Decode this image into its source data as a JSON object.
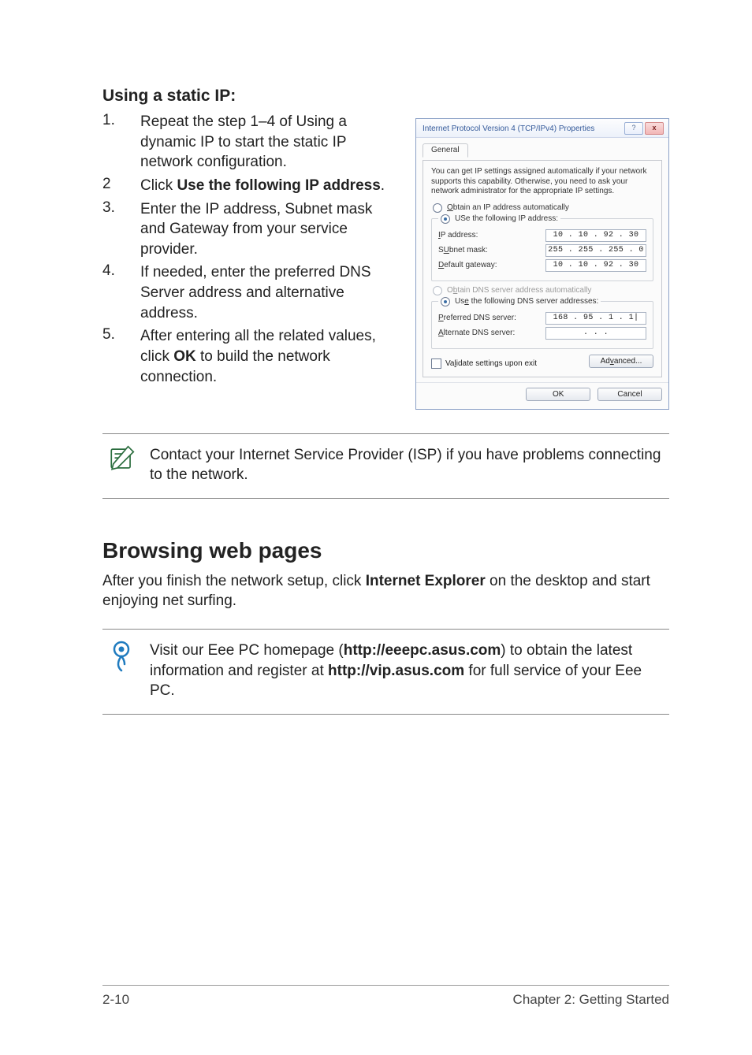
{
  "section1_title": "Using a static IP:",
  "steps": [
    {
      "num": "1.",
      "text": "Repeat the step 1–4 of Using a dynamic IP to start the static IP network configuration."
    },
    {
      "num": "2",
      "text_pre": "Click ",
      "text_bold": "Use the following IP address",
      "text_post": "."
    },
    {
      "num": "3.",
      "text": "Enter the IP address, Subnet mask and Gateway from your service provider."
    },
    {
      "num": "4.",
      "text": "If needed, enter the preferred DNS Server address and alternative address."
    },
    {
      "num": "5.",
      "text_pre": "After entering all the related values, click ",
      "text_bold": "OK",
      "text_post": " to build the network connection."
    }
  ],
  "dialog": {
    "title": "Internet Protocol Version 4 (TCP/IPv4) Properties",
    "help_glyph": "?",
    "close_glyph": "x",
    "tab": "General",
    "desc": "You can get IP settings assigned automatically if your network supports this capability. Otherwise, you need to ask your network administrator for the appropriate IP settings.",
    "radio_auto_ip": "Obtain an IP address automatically",
    "radio_manual_ip": "Use the following IP address:",
    "ip_label": "IP address:",
    "ip_value": "10 . 10 . 92 . 30",
    "subnet_label": "Subnet mask:",
    "subnet_value": "255 . 255 . 255 .  0",
    "gateway_label": "Default gateway:",
    "gateway_value": "10 . 10 . 92 . 30",
    "radio_auto_dns": "Obtain DNS server address automatically",
    "radio_manual_dns": "Use the following DNS server addresses:",
    "pref_dns_label": "Preferred DNS server:",
    "pref_dns_value": "168 . 95 .  1 .  1|",
    "alt_dns_label": "Alternate DNS server:",
    "alt_dns_value": " .        .        . ",
    "validate_label": "Validate settings upon exit",
    "advanced_btn": "Advanced...",
    "ok_btn": "OK",
    "cancel_btn": "Cancel",
    "underline": {
      "O": "O",
      "U": "U",
      "I": "I",
      "S": "S",
      "D": "D",
      "b": "b",
      "e": "e",
      "P": "P",
      "A": "A",
      "l": "l",
      "v": "v"
    }
  },
  "note1": "Contact your Internet Service Provider (ISP) if you have problems connecting to the network.",
  "section2_title": "Browsing web pages",
  "section2_body_pre": "After you finish the network setup, click ",
  "section2_body_bold": "Internet Explorer",
  "section2_body_post": " on the desktop and start enjoying net surfing.",
  "note2_pre": "Visit our Eee PC homepage (",
  "note2_bold1": "http://eeepc.asus.com",
  "note2_mid": ") to obtain the latest information and register at ",
  "note2_bold2": "http://vip.asus.com",
  "note2_post": " for full service of your Eee PC.",
  "footer_left": "2-10",
  "footer_right": "Chapter 2: Getting Started"
}
